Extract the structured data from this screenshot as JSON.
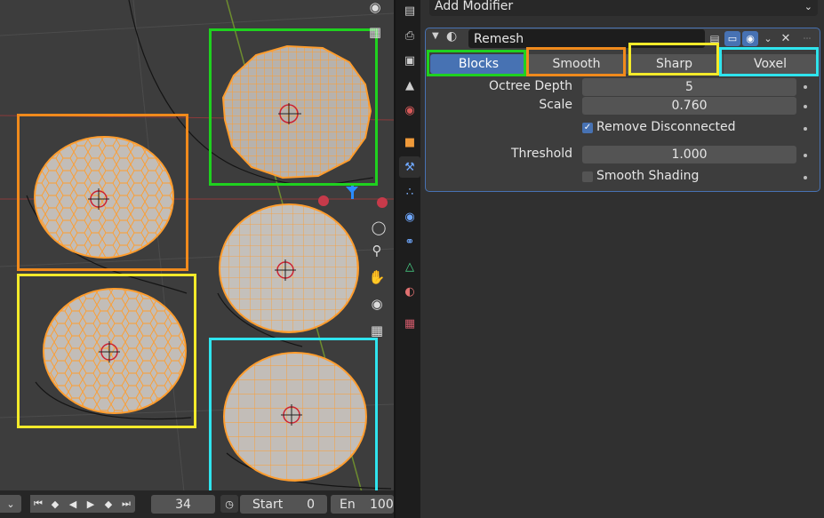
{
  "properties": {
    "add_modifier": "Add Modifier",
    "modifier": {
      "name": "Remesh",
      "modes": [
        "Blocks",
        "Smooth",
        "Sharp",
        "Voxel"
      ],
      "active_mode": "Blocks",
      "octree_depth_label": "Octree Depth",
      "octree_depth": "5",
      "scale_label": "Scale",
      "scale": "0.760",
      "remove_disconnected_label": "Remove Disconnected",
      "remove_disconnected": true,
      "threshold_label": "Threshold",
      "threshold": "1.000",
      "smooth_shading_label": "Smooth Shading",
      "smooth_shading": false
    }
  },
  "timeline": {
    "current_frame": "34",
    "start_label": "Start",
    "start_value": "0",
    "end_label": "En",
    "end_value": "100"
  },
  "colors": {
    "blocks_highlight": "#1fd11f",
    "smooth_highlight": "#f08a1c",
    "sharp_highlight": "#f3ea2a",
    "voxel_highlight": "#2fe4ee",
    "accent": "#4772b3",
    "mesh_wire": "#ff9d2e"
  }
}
